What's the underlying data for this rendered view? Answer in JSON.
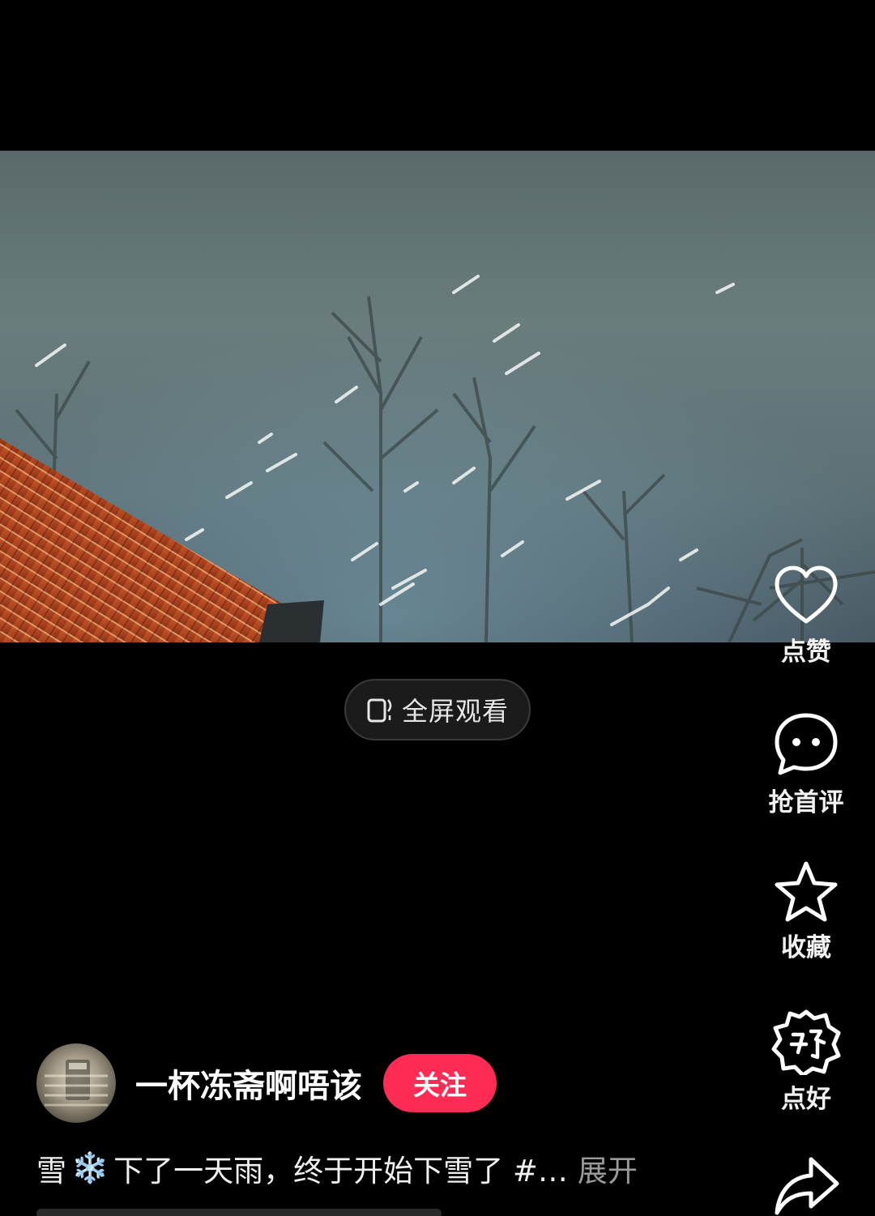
{
  "video": {
    "scene": "snow-night-video"
  },
  "fullscreen": {
    "label": "全屏观看"
  },
  "actions": {
    "like_label": "点赞",
    "comment_label": "抢首评",
    "favorite_label": "收藏",
    "good_label": "点好"
  },
  "author": {
    "name": "一杯冻斋啊唔该",
    "follow_label": "关注"
  },
  "caption": {
    "lead": "雪",
    "emoji": "❄️",
    "text": "下了一天雨，终于开始下雪了 #…",
    "expand": "展开"
  },
  "colors": {
    "follow": "#fe2c55",
    "background": "#000000"
  }
}
